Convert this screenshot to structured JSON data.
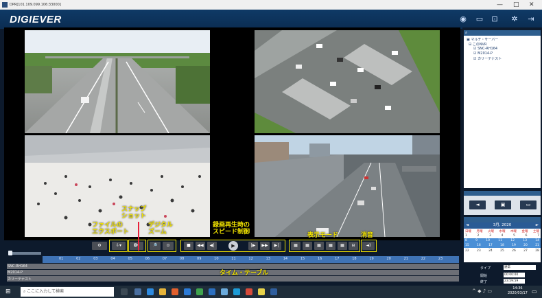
{
  "window": {
    "title": "DPR[101.109.099.106:33000]",
    "minimize": "—",
    "maximize": "□",
    "close": "✕"
  },
  "app": {
    "logo": "DIGIEVER",
    "header_icons": [
      "globe-icon",
      "layout-icon",
      "playback-icon",
      "settings-icon",
      "logout-icon"
    ]
  },
  "sidebar": {
    "search_icon": "search-icon",
    "tree": [
      {
        "label": "マルチ・サーバー"
      },
      {
        "label": "このNVR"
      },
      {
        "label": "SNC-RH164"
      },
      {
        "label": "M2014-P"
      },
      {
        "label": "カリーテナスト"
      }
    ],
    "buttons": [
      "◄",
      "▣",
      "▭"
    ]
  },
  "calendar": {
    "header": "3月, 2020",
    "weekdays": [
      "日曜",
      "月曜",
      "火曜",
      "水曜",
      "木曜",
      "金曜",
      "土曜"
    ],
    "rows": [
      [
        "1",
        "2",
        "3",
        "4",
        "5",
        "6",
        "7"
      ],
      [
        "8",
        "9",
        "10",
        "11",
        "12",
        "13",
        "14"
      ],
      [
        "15",
        "16",
        "17",
        "18",
        "19",
        "20",
        "21"
      ],
      [
        "22",
        "23",
        "24",
        "25",
        "26",
        "27",
        "28"
      ]
    ],
    "type_label": "タイプ",
    "type_value": "通常",
    "start_label": "開始",
    "start_value": "00:00:00",
    "end_label": "終了",
    "end_value": "23:59:59"
  },
  "controls": {
    "buttons": [
      "⚙",
      "⇩▾",
      "◘▾",
      "🔎",
      "⊙",
      "■",
      "◀◀",
      "◀|",
      "▶",
      "|▶",
      "▶▶",
      "▶|",
      "▦",
      "▦",
      "▦",
      "▦",
      "▦",
      "⊟",
      "◄)"
    ]
  },
  "annotations": {
    "export": "ファイルの\nエクスポート",
    "snapshot": "スナップ\nショット",
    "zoom": "デジタル\nズーム",
    "speed": "録画再生時の\nスピード制御",
    "display_mode": "表示モード",
    "mute": "消音",
    "timetable": "タイム・テーブル"
  },
  "timeline": {
    "hours": [
      "01",
      "02",
      "03",
      "04",
      "05",
      "06",
      "07",
      "08",
      "09",
      "10",
      "11",
      "12",
      "13",
      "14",
      "15",
      "16",
      "17",
      "18",
      "19",
      "20",
      "21",
      "22",
      "23"
    ],
    "channels": [
      "SNC-RH164",
      "M2014-P",
      "カリーテナスト"
    ]
  },
  "taskbar": {
    "search_placeholder": "ここに入力して検索",
    "time": "14:36",
    "date": "2020/03/17"
  },
  "colors": {
    "annotation_yellow": "#f0e000",
    "timeline_blue": "#3f73b5",
    "header_blue": "#0f3a66"
  }
}
